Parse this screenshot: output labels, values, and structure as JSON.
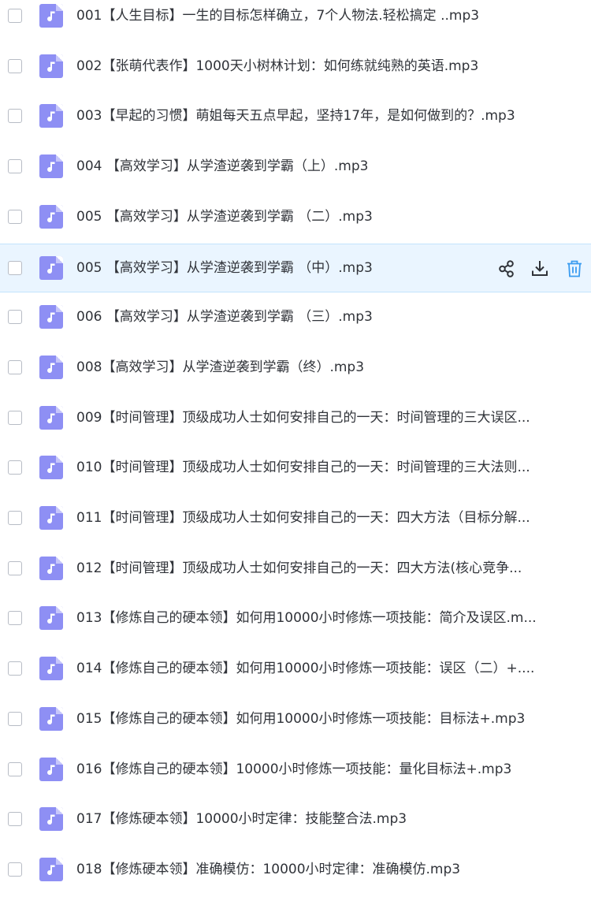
{
  "files": [
    {
      "name": "001【人生目标】一生的目标怎样确立，7个人物法.轻松搞定  ..mp3"
    },
    {
      "name": "002【张萌代表作】1000天小树林计划：如何练就纯熟的英语.mp3"
    },
    {
      "name": "003【早起的习惯】萌姐每天五点早起，坚持17年，是如何做到的？.mp3"
    },
    {
      "name": "004 【高效学习】从学渣逆袭到学霸（上）.mp3"
    },
    {
      "name": "005 【高效学习】从学渣逆袭到学霸 （二）.mp3"
    },
    {
      "name": "005 【高效学习】从学渣逆袭到学霸 （中）.mp3"
    },
    {
      "name": "006 【高效学习】从学渣逆袭到学霸 （三）.mp3"
    },
    {
      "name": "008【高效学习】从学渣逆袭到学霸（终）.mp3"
    },
    {
      "name": "009【时间管理】顶级成功人士如何安排自己的一天：时间管理的三大误区..."
    },
    {
      "name": "010【时间管理】顶级成功人士如何安排自己的一天：时间管理的三大法则..."
    },
    {
      "name": "011【时间管理】顶级成功人士如何安排自己的一天：四大方法（目标分解..."
    },
    {
      "name": "012【时间管理】顶级成功人士如何安排自己的一天：四大方法(核心竞争..."
    },
    {
      "name": "013【修炼自己的硬本领】如何用10000小时修炼一项技能：简介及误区.m..."
    },
    {
      "name": "014【修炼自己的硬本领】如何用10000小时修炼一项技能：误区（二）+...."
    },
    {
      "name": "015【修炼自己的硬本领】如何用10000小时修炼一项技能：目标法+.mp3"
    },
    {
      "name": "016【修炼自己的硬本领】10000小时修炼一项技能：量化目标法+.mp3"
    },
    {
      "name": "017【修炼硬本领】10000小时定律：技能整合法.mp3"
    },
    {
      "name": "018【修炼硬本领】准确模仿：10000小时定律：准确模仿.mp3"
    }
  ],
  "hovered_index": 5,
  "icons": {
    "file_type": "music-note-icon",
    "share": "share-icon",
    "download": "download-icon",
    "delete": "trash-icon"
  },
  "colors": {
    "file_icon": "#8e8ff4",
    "hover_background": "#eaf5ff",
    "hover_border": "#c3e4fc",
    "action_icon": "#303339",
    "delete_icon": "#3a9cf0",
    "text": "#303339"
  }
}
